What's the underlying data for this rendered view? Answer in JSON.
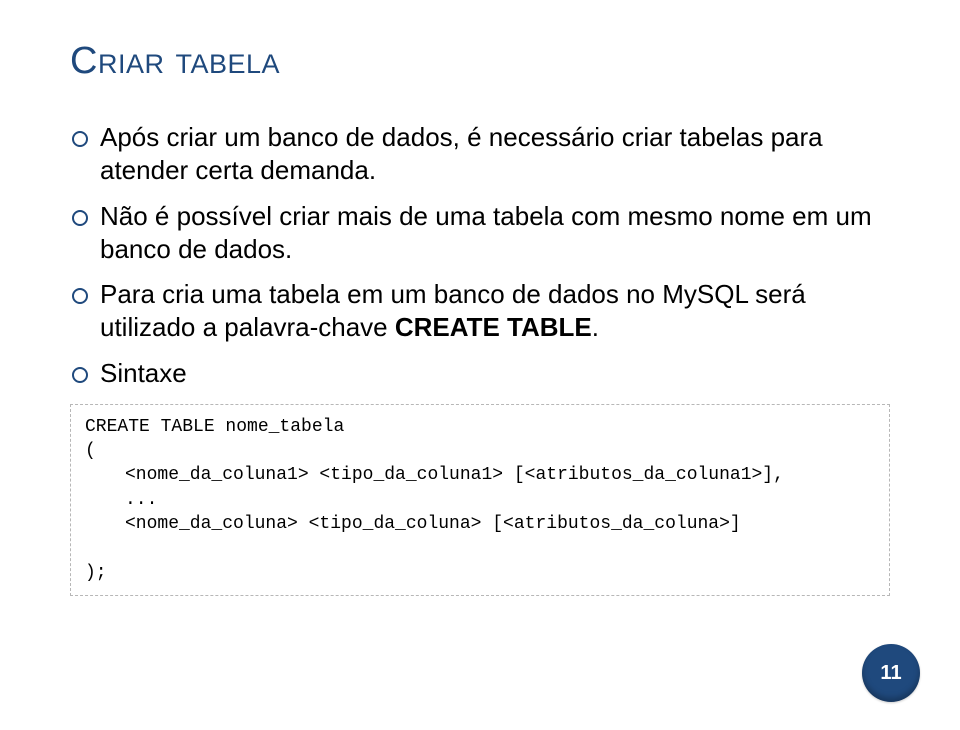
{
  "title": "Criar tabela",
  "bullets": [
    {
      "text": "Após criar um banco de dados, é necessário criar tabelas para atender certa demanda."
    },
    {
      "text": "Não é possível criar mais de uma tabela com mesmo nome em um banco de dados."
    },
    {
      "prefix": "Para cria uma tabela em um banco de dados no MySQL será utilizado a palavra-chave ",
      "strong": "CREATE TABLE",
      "suffix": "."
    },
    {
      "text": "Sintaxe"
    }
  ],
  "code": {
    "line1": "CREATE TABLE nome_tabela",
    "line2": "(",
    "line3": "<nome_da_coluna1> <tipo_da_coluna1> [<atributos_da_coluna1>],",
    "line4": "...",
    "line5": "<nome_da_coluna> <tipo_da_coluna> [<atributos_da_coluna>]",
    "line6": ");"
  },
  "page_number": "11"
}
